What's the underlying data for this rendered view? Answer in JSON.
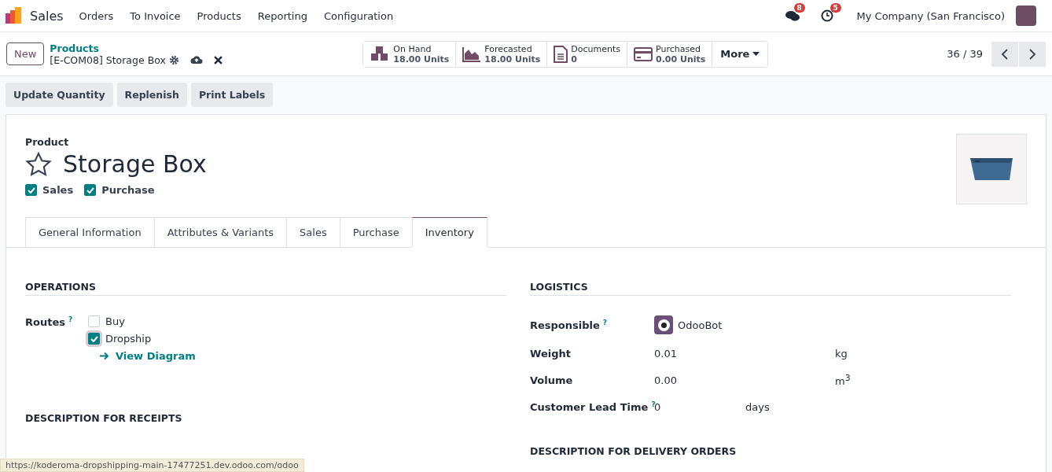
{
  "navbar": {
    "app": "Sales",
    "menu": [
      "Orders",
      "To Invoice",
      "Products",
      "Reporting",
      "Configuration"
    ],
    "messages_badge": "8",
    "activities_badge": "5",
    "company": "My Company (San Francisco)"
  },
  "control_panel": {
    "new_button": "New",
    "breadcrumb": "Products",
    "record_title": "[E-COM08] Storage Box",
    "smart_buttons": [
      {
        "kind": "onhand",
        "label": "On Hand",
        "value": "18.00 Units"
      },
      {
        "kind": "forecast",
        "label": "Forecasted",
        "value": "18.00 Units"
      },
      {
        "kind": "documents",
        "label": "Documents",
        "value": "0"
      },
      {
        "kind": "purchased",
        "label": "Purchased",
        "value": "0.00 Units"
      }
    ],
    "more_button": "More",
    "pager": "36 / 39"
  },
  "actions": [
    "Update Quantity",
    "Replenish",
    "Print Labels"
  ],
  "form": {
    "label": "Product",
    "name": "Storage Box",
    "favorite": false,
    "flags": [
      {
        "label": "Sales",
        "checked": true
      },
      {
        "label": "Purchase",
        "checked": true
      }
    ],
    "tabs": [
      {
        "label": "General Information",
        "selected": false
      },
      {
        "label": "Attributes & Variants",
        "selected": false
      },
      {
        "label": "Sales",
        "selected": false
      },
      {
        "label": "Purchase",
        "selected": false
      },
      {
        "label": "Inventory",
        "selected": true
      }
    ],
    "operations": {
      "title": "OPERATIONS",
      "routes_label": "Routes",
      "help": "?",
      "routes": [
        {
          "label": "Buy",
          "checked": false
        },
        {
          "label": "Dropship",
          "checked": true
        }
      ],
      "diagram_link": "View Diagram"
    },
    "logistics": {
      "title": "LOGISTICS",
      "fields": [
        {
          "kind": "user",
          "label": "Responsible",
          "help": "?",
          "value": "OdooBot"
        },
        {
          "kind": "number",
          "label": "Weight",
          "value": "0.01",
          "unit": "kg"
        },
        {
          "kind": "number",
          "label": "Volume",
          "value": "0.00",
          "unit": "m$^{3}$"
        },
        {
          "kind": "days",
          "label": "Customer Lead Time",
          "help": "?",
          "value": "0",
          "unit": "days"
        }
      ]
    },
    "receipts_title": "DESCRIPTION FOR RECEIPTS",
    "delivery_title": "DESCRIPTION FOR DELIVERY ORDERS"
  },
  "status_url": "https://koderoma-dropshipping-main-17477251.dev.odoo.com/odoo"
}
